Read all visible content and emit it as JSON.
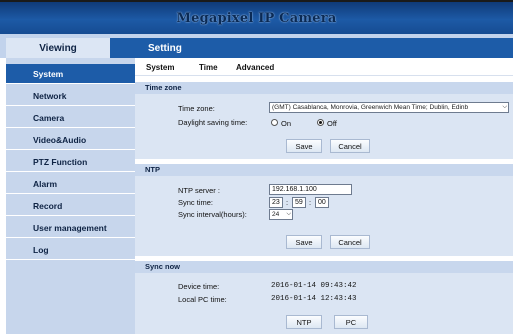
{
  "header": {
    "title": "Megapixel IP Camera"
  },
  "main_nav": {
    "viewing": "Viewing",
    "setting": "Setting"
  },
  "sidebar": {
    "items": [
      {
        "label": "System"
      },
      {
        "label": "Network"
      },
      {
        "label": "Camera"
      },
      {
        "label": "Video&Audio"
      },
      {
        "label": "PTZ Function"
      },
      {
        "label": "Alarm"
      },
      {
        "label": "Record"
      },
      {
        "label": "User management"
      },
      {
        "label": "Log"
      }
    ]
  },
  "sub_tabs": {
    "system": "System",
    "time": "Time",
    "advanced": "Advanced"
  },
  "timezone_section": {
    "title": "Time zone",
    "timezone_label": "Time zone:",
    "timezone_value": "(GMT) Casablanca, Monrovia, Greenwich Mean Time; Dublin, Edinb",
    "dst_label": "Daylight saving time:",
    "dst_on": "On",
    "dst_off": "Off",
    "save": "Save",
    "cancel": "Cancel"
  },
  "ntp_section": {
    "title": "NTP",
    "server_label": "NTP server :",
    "server_value": "192.168.1.100",
    "sync_time_label": "Sync time:",
    "sync_hour": "23",
    "sync_minute": "59",
    "sync_second": "00",
    "interval_label": "Sync interval(hours):",
    "interval_value": "24",
    "save": "Save",
    "cancel": "Cancel"
  },
  "sync_section": {
    "title": "Sync now",
    "device_time_label": "Device time:",
    "device_time_value": "2016-01-14 09:43:42",
    "pc_time_label": "Local PC time:",
    "pc_time_value": "2016-01-14 12:43:43",
    "ntp_button": "NTP",
    "pc_button": "PC"
  }
}
